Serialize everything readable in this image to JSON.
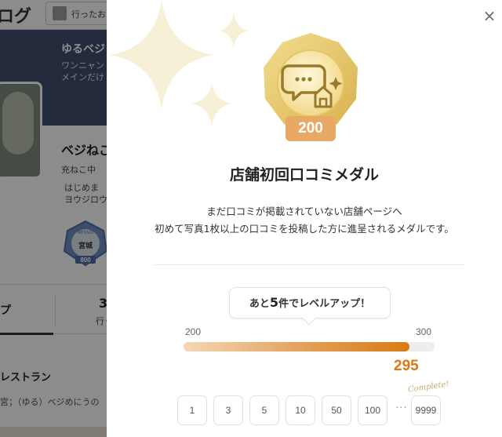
{
  "background": {
    "logo": "ログ",
    "search_text": "行ったお",
    "profile_name": "ゆるベジ",
    "profile_desc": "ワンニャン\nメインだけ",
    "user_name": "ベジねこ",
    "status": "充ねこ中",
    "bio": "はじめま\nヨウジロウ",
    "badge": {
      "region": "MIYAGI",
      "pref": "宮城",
      "level": "800"
    },
    "tab1": "プ",
    "tab2_count": "3",
    "tab2_label": "行っ",
    "section_title": "レストラン",
    "row_text": "宮；（ゆる）ベジめにうの"
  },
  "modal": {
    "close_label": "×",
    "medal_level": "200",
    "title": "店舗初回口コミメダル",
    "description_line1": "まだ口コミが掲載されていない店舗ページへ",
    "description_line2": "初めて写真1枚以上の口コミを投稿した方に進呈されるメダルです。",
    "levelup": {
      "prefix": "あと",
      "count": "5",
      "suffix": "件でレベルアップ！"
    },
    "progress": {
      "min_label": "200",
      "max_label": "300",
      "current_label": "295",
      "fraction": 0.9
    },
    "complete_label": "Complete!",
    "levels": [
      "1",
      "3",
      "5",
      "10",
      "50",
      "100",
      "9999"
    ],
    "ellipsis": "···"
  },
  "colors": {
    "accent_orange": "#d97a14",
    "medal_gold": "#e8c86a",
    "level_plate": "#e9a966",
    "sparkle": "#f6f0d6"
  }
}
